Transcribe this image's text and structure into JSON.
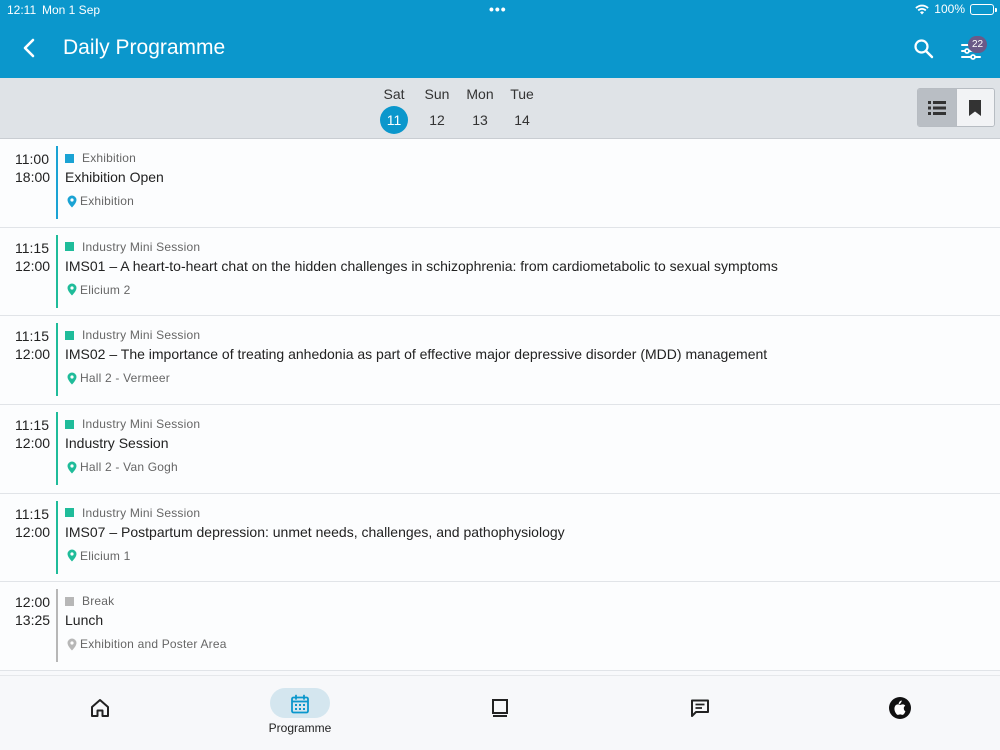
{
  "status_bar": {
    "time": "12:11",
    "date": "Mon 1 Sep",
    "battery": "100%"
  },
  "header": {
    "title": "Daily Programme",
    "filter_badge": "22",
    "background_color": "#0b97cc"
  },
  "days": [
    {
      "dow": "Sat",
      "num": "11",
      "active": true
    },
    {
      "dow": "Sun",
      "num": "12",
      "active": false
    },
    {
      "dow": "Mon",
      "num": "13",
      "active": false
    },
    {
      "dow": "Tue",
      "num": "14",
      "active": false
    }
  ],
  "view_toggle": {
    "selected": "list"
  },
  "sessions": [
    {
      "start": "11:00",
      "end": "18:00",
      "type": "Exhibition",
      "title": "Exhibition Open",
      "location": "Exhibition",
      "color": "#1aa3d4"
    },
    {
      "start": "11:15",
      "end": "12:00",
      "type": "Industry Mini Session",
      "title": "IMS01 – A heart-to-heart chat on the hidden challenges in schizophrenia: from cardiometabolic to sexual symptoms",
      "location": "Elicium 2",
      "color": "#1fbc9a"
    },
    {
      "start": "11:15",
      "end": "12:00",
      "type": "Industry Mini Session",
      "title": "IMS02 – The importance of treating anhedonia as part of effective major depressive disorder (MDD) management",
      "location": "Hall 2 - Vermeer",
      "color": "#1fbc9a"
    },
    {
      "start": "11:15",
      "end": "12:00",
      "type": "Industry Mini Session",
      "title": "Industry Session",
      "location": "Hall 2 - Van Gogh",
      "color": "#1fbc9a"
    },
    {
      "start": "11:15",
      "end": "12:00",
      "type": "Industry Mini Session",
      "title": "IMS07 – Postpartum depression: unmet needs, challenges, and pathophysiology",
      "location": "Elicium 1",
      "color": "#1fbc9a"
    },
    {
      "start": "12:00",
      "end": "13:25",
      "type": "Break",
      "title": "Lunch",
      "location": "Exhibition and Poster Area",
      "color": "#b7b7b7"
    }
  ],
  "tabs": [
    {
      "icon": "home-icon",
      "label": ""
    },
    {
      "icon": "calendar-icon",
      "label": "Programme",
      "active": true
    },
    {
      "icon": "book-icon",
      "label": ""
    },
    {
      "icon": "chat-icon",
      "label": ""
    },
    {
      "icon": "app-logo-icon",
      "label": ""
    }
  ]
}
